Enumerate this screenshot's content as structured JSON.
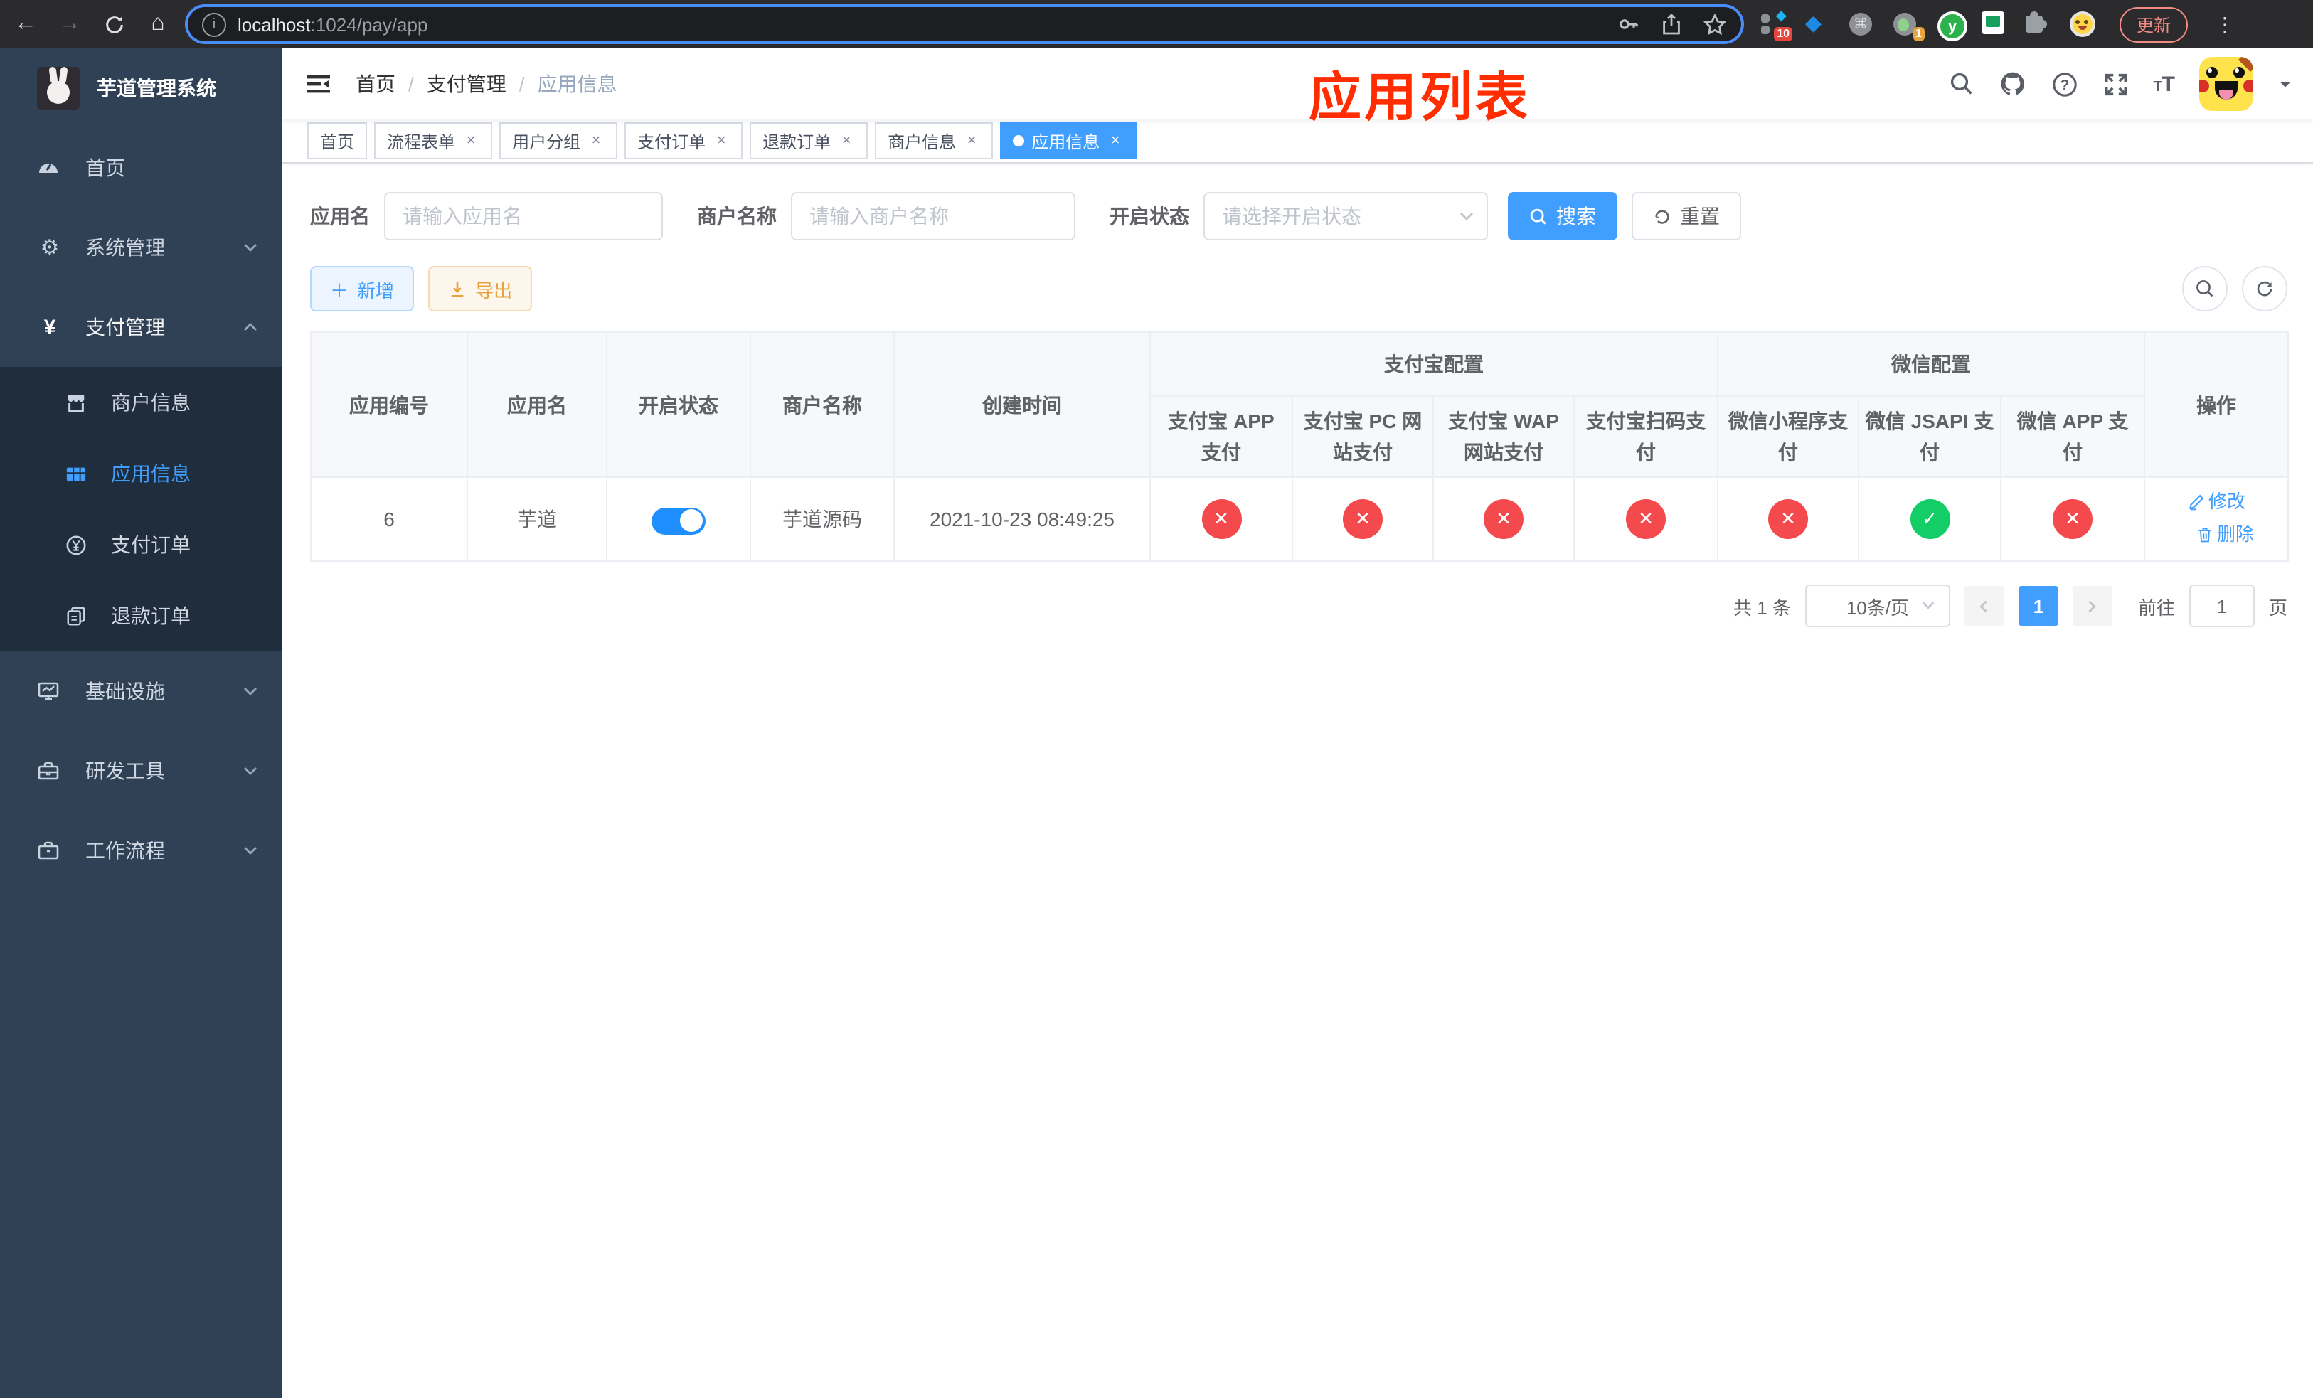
{
  "browser": {
    "url_host": "localhost",
    "url_path": ":1024/pay/app",
    "update_button": "更新",
    "ext_badge_count": "10",
    "ext_badge_one": "1",
    "icons": {
      "back": "←",
      "forward": "→",
      "home": "⌂",
      "info": "i",
      "command": "⌘",
      "gem": "◆",
      "menu_dots": "⋮",
      "y_logo": "y"
    }
  },
  "sidebar": {
    "title": "芋道管理系统",
    "items": [
      {
        "label": "首页"
      },
      {
        "label": "系统管理"
      },
      {
        "label": "支付管理"
      },
      {
        "label": "基础设施"
      },
      {
        "label": "研发工具"
      },
      {
        "label": "工作流程"
      }
    ],
    "submenu": [
      {
        "label": "商户信息"
      },
      {
        "label": "应用信息"
      },
      {
        "label": "支付订单"
      },
      {
        "label": "退款订单"
      }
    ],
    "yen_glyph": "¥",
    "gear_glyph": "⚙"
  },
  "navbar": {
    "breadcrumb": [
      {
        "label": "首页"
      },
      {
        "label": "支付管理"
      },
      {
        "label": "应用信息"
      }
    ],
    "separator": "/",
    "font_icon_large": "T",
    "font_icon_small": "T"
  },
  "annotation": "应用列表",
  "tabbar": {
    "close_glyph": "×",
    "tabs": [
      {
        "label": "首页"
      },
      {
        "label": "流程表单"
      },
      {
        "label": "用户分组"
      },
      {
        "label": "支付订单"
      },
      {
        "label": "退款订单"
      },
      {
        "label": "商户信息"
      },
      {
        "label": "应用信息"
      }
    ]
  },
  "search": {
    "app_name": {
      "label": "应用名",
      "placeholder": "请输入应用名",
      "value": ""
    },
    "merchant_name": {
      "label": "商户名称",
      "placeholder": "请输入商户名称",
      "value": ""
    },
    "status": {
      "label": "开启状态",
      "placeholder": "请选择开启状态"
    },
    "search_button": "搜索",
    "reset_button": "重置"
  },
  "toolbar": {
    "add_button": "新增",
    "export_button": "导出",
    "plus_glyph": "＋"
  },
  "table": {
    "group_alipay": "支付宝配置",
    "group_wechat": "微信配置",
    "columns": [
      "应用编号",
      "应用名",
      "开启状态",
      "商户名称",
      "创建时间",
      "支付宝 APP 支付",
      "支付宝 PC 网站支付",
      "支付宝 WAP 网站支付",
      "支付宝扫码支付",
      "微信小程序支付",
      "微信 JSAPI 支付",
      "微信 APP 支付",
      "操作"
    ],
    "row": {
      "id": "6",
      "name": "芋道",
      "enabled": true,
      "merchant": "芋道源码",
      "created": "2021-10-23 08:49:25",
      "configs": [
        "fail",
        "fail",
        "fail",
        "fail",
        "fail",
        "ok",
        "fail"
      ],
      "edit_label": "修改",
      "delete_label": "删除"
    },
    "glyph_ok": "✓",
    "glyph_fail": "✕"
  },
  "pagination": {
    "total_text": "共 1 条",
    "page_size": "10条/页",
    "current_page": "1",
    "goto_prefix": "前往",
    "goto_value": "1",
    "goto_suffix": "页"
  },
  "colors": {
    "primary": "#409eff",
    "sidebar_bg": "#304156",
    "submenu_bg": "#1f2d3d",
    "danger_circle": "#f4494d",
    "success_circle": "#13ce66",
    "annotation_red": "#ff2d00",
    "warning_text": "#e6a23c"
  }
}
